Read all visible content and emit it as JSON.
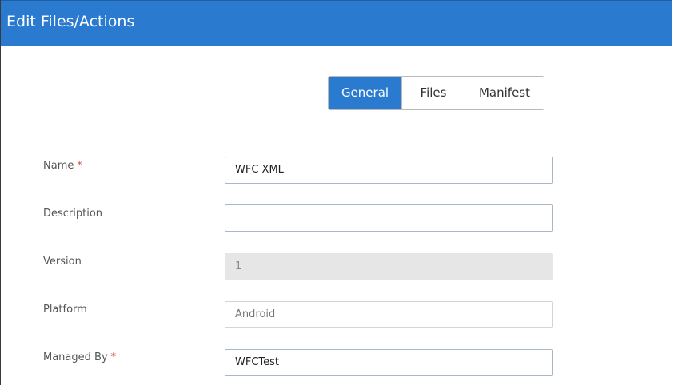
{
  "dialog": {
    "title": "Edit Files/Actions"
  },
  "tabs": [
    {
      "label": "General",
      "active": true
    },
    {
      "label": "Files",
      "active": false
    },
    {
      "label": "Manifest",
      "active": false
    }
  ],
  "form": {
    "name": {
      "label": "Name",
      "required_mark": "*",
      "value": "WFC XML"
    },
    "description": {
      "label": "Description",
      "value": ""
    },
    "version": {
      "label": "Version",
      "value": "1"
    },
    "platform": {
      "label": "Platform",
      "value": "Android"
    },
    "managed_by": {
      "label": "Managed By",
      "required_mark": "*",
      "value": "WFCTest"
    }
  },
  "colors": {
    "header": "#2a7bd0",
    "active_tab": "#2a7bd0",
    "required": "#d9534f"
  }
}
